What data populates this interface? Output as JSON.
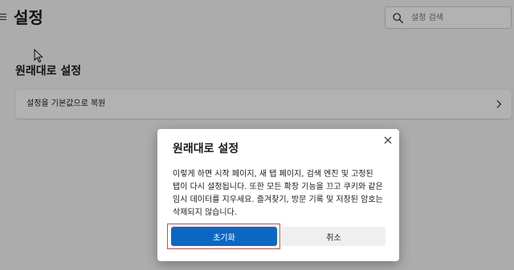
{
  "header": {
    "title": "설정",
    "search": {
      "placeholder": "설정 검색",
      "value": ""
    }
  },
  "main": {
    "section_title": "원래대로 설정",
    "rows": [
      {
        "label": "설정을 기본값으로 복원"
      }
    ]
  },
  "dialog": {
    "title": "원래대로 설정",
    "message": "이렇게 하면 시작 페이지, 새 탭 페이지, 검색 엔진 및 고정된 탭이 다시 설정됩니다. 또한 모든 확장 기능을 끄고 쿠키와 같은 임시 데이터를 지우세요. 즐겨찾기, 방문 기록 및 저장된 암호는 삭제되지 않습니다.",
    "confirm_label": "초기화",
    "cancel_label": "취소"
  },
  "colors": {
    "accent": "#0c67c4",
    "focus_highlight": "#d64545",
    "background": "#f7f7f7"
  },
  "icons": {
    "menu": "hamburger-menu-icon",
    "search": "search-icon",
    "row_chevron": "chevron-right-icon",
    "close": "close-icon"
  }
}
